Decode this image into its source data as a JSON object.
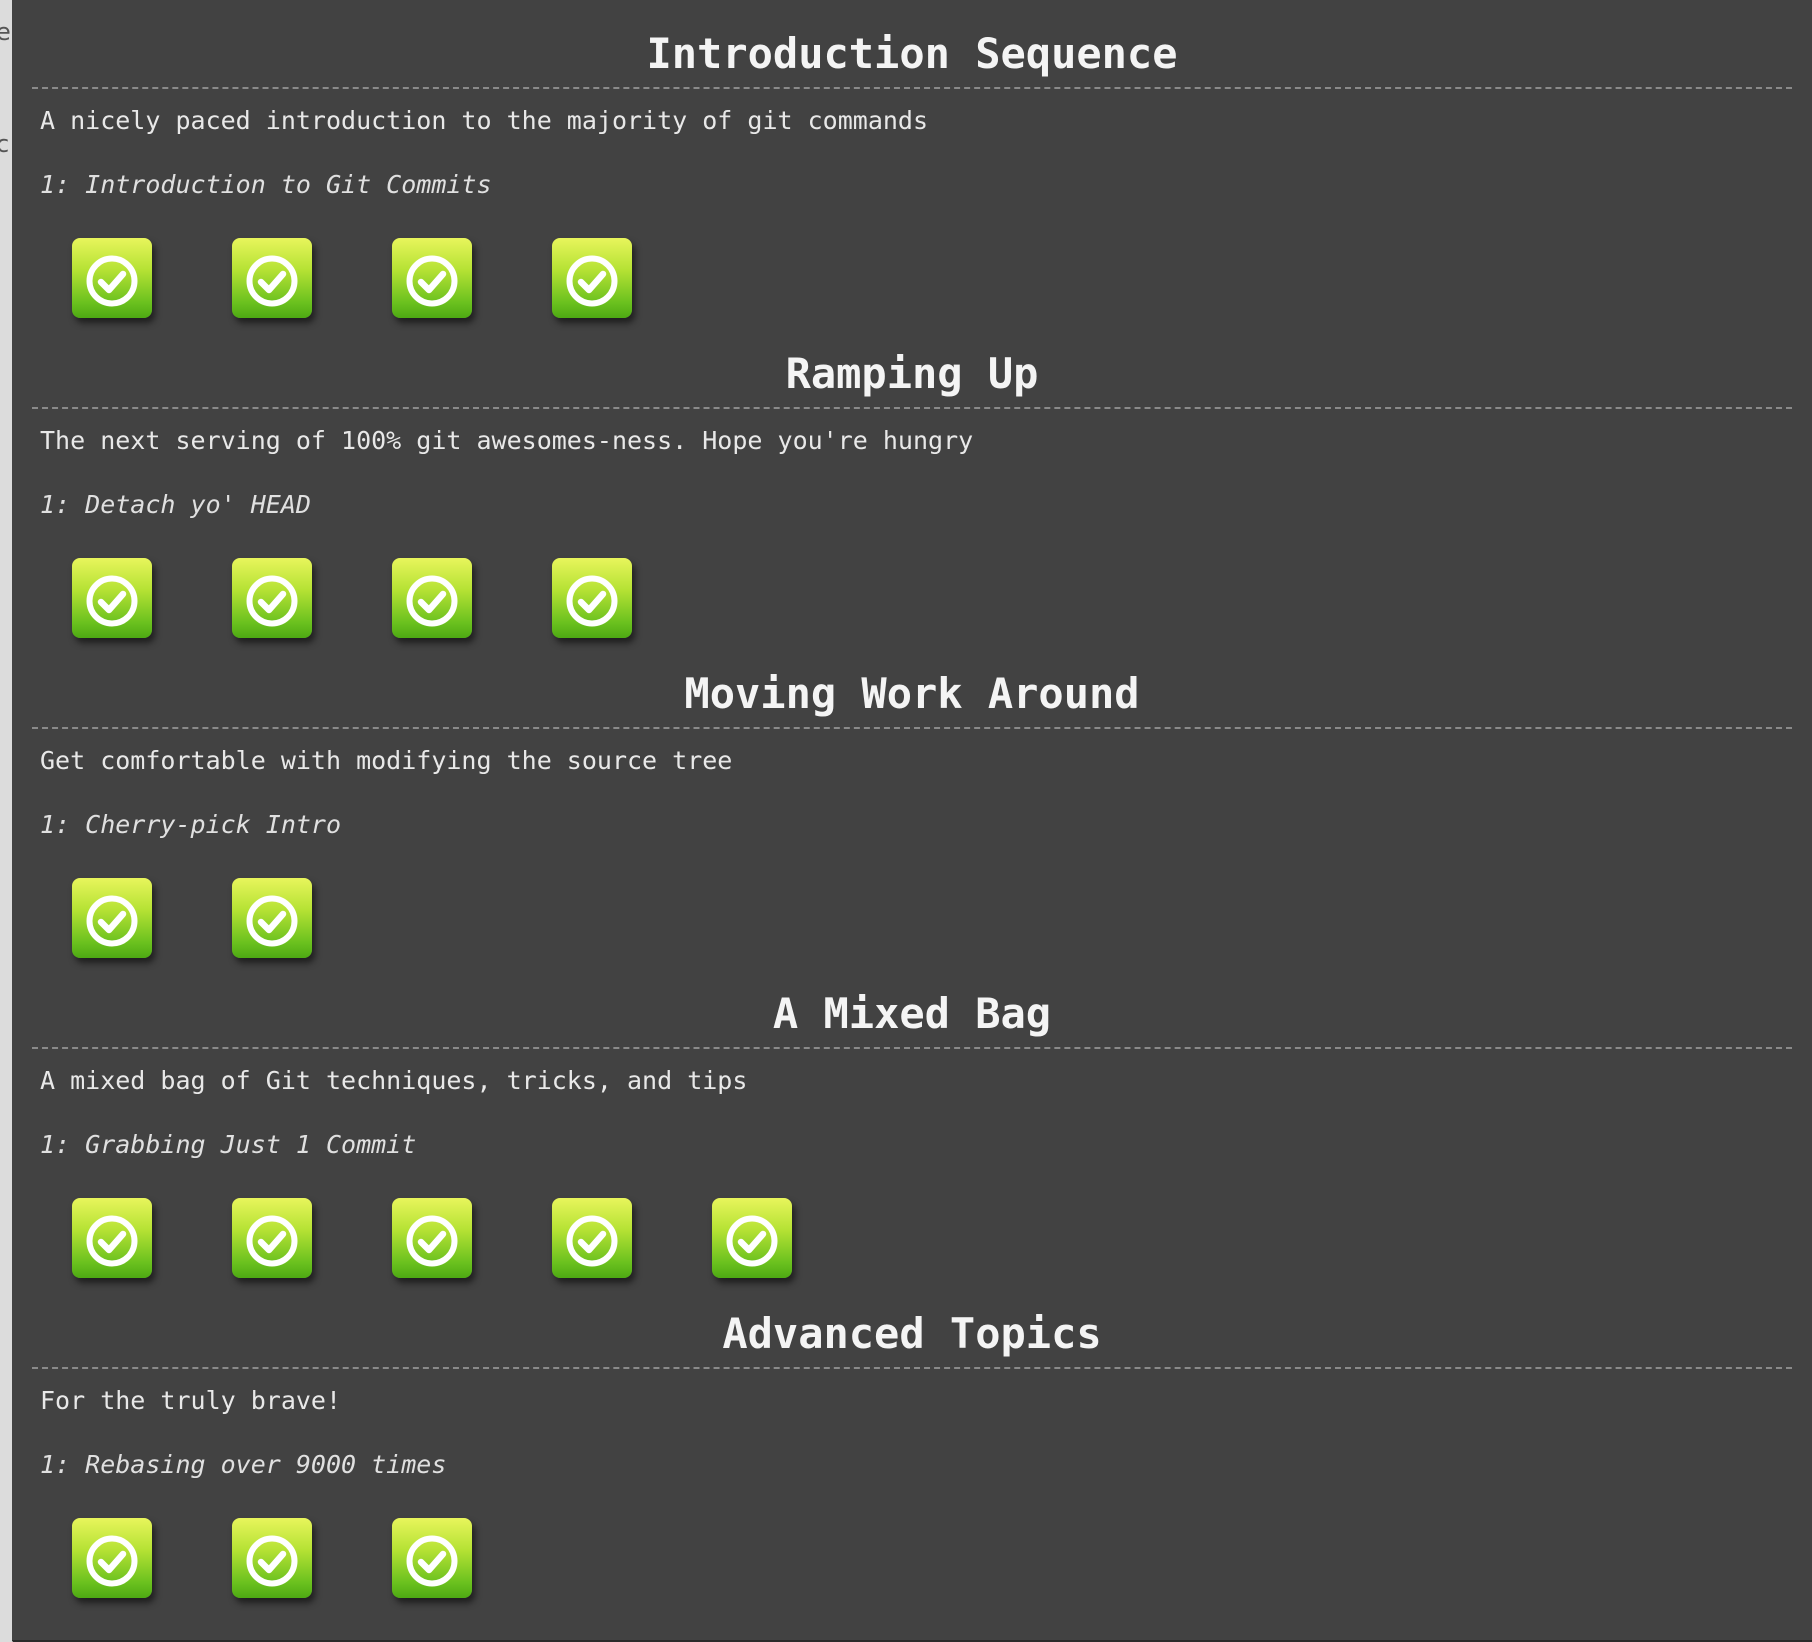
{
  "edge_chars": [
    "e",
    "c"
  ],
  "check_icon": "check-circle-icon",
  "colors": {
    "panel_background": "#424242",
    "icon_gradient_top": "#e8f55c",
    "icon_gradient_bottom": "#4da913",
    "text": "#f4f4f4"
  },
  "sequences": [
    {
      "title": "Introduction Sequence",
      "description": "A nicely paced introduction to the majority of git commands",
      "level_name": "1: Introduction to Git Commits",
      "levels": [
        {
          "status": "complete"
        },
        {
          "status": "complete"
        },
        {
          "status": "complete"
        },
        {
          "status": "complete"
        }
      ]
    },
    {
      "title": "Ramping Up",
      "description": "The next serving of 100% git awesomes-ness. Hope you're hungry",
      "level_name": "1: Detach yo' HEAD",
      "levels": [
        {
          "status": "complete"
        },
        {
          "status": "complete"
        },
        {
          "status": "complete"
        },
        {
          "status": "complete"
        }
      ]
    },
    {
      "title": "Moving Work Around",
      "description": "Get comfortable with modifying the source tree",
      "level_name": "1: Cherry-pick Intro",
      "levels": [
        {
          "status": "complete"
        },
        {
          "status": "complete"
        }
      ]
    },
    {
      "title": "A Mixed Bag",
      "description": "A mixed bag of Git techniques, tricks, and tips",
      "level_name": "1: Grabbing Just 1 Commit",
      "levels": [
        {
          "status": "complete"
        },
        {
          "status": "complete"
        },
        {
          "status": "complete"
        },
        {
          "status": "complete"
        },
        {
          "status": "complete"
        }
      ]
    },
    {
      "title": "Advanced Topics",
      "description": "For the truly brave!",
      "level_name": "1: Rebasing over 9000 times",
      "levels": [
        {
          "status": "complete"
        },
        {
          "status": "complete"
        },
        {
          "status": "complete"
        }
      ]
    }
  ]
}
